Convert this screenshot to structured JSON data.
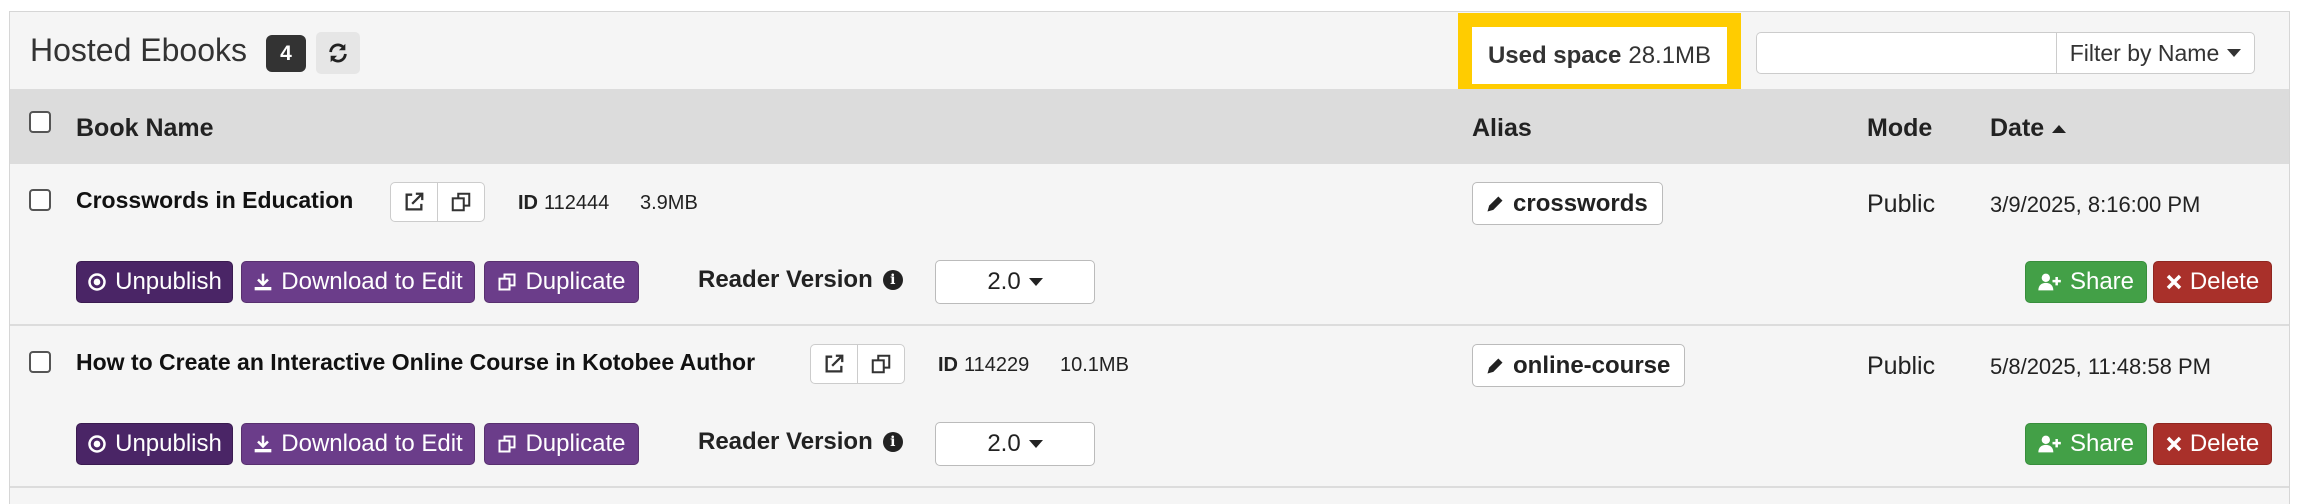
{
  "header": {
    "title": "Hosted Ebooks",
    "count": "4",
    "used_space_label": "Used space",
    "used_space_value": "28.1MB",
    "filter_value": "",
    "filter_button": "Filter by Name"
  },
  "table": {
    "columns": {
      "name": "Book Name",
      "alias": "Alias",
      "mode": "Mode",
      "date": "Date"
    },
    "sort": "date-ascending",
    "rows": [
      {
        "name": "Crosswords in Education",
        "id_label": "ID",
        "id": "112444",
        "size": "3.9MB",
        "alias": "crosswords",
        "mode": "Public",
        "date": "3/9/2025, 8:16:00 PM",
        "unpublish": "Unpublish",
        "download": "Download to Edit",
        "duplicate": "Duplicate",
        "reader_label": "Reader Version",
        "reader_version": "2.0",
        "share": "Share",
        "delete": "Delete"
      },
      {
        "name": "How to Create an Interactive Online Course in Kotobee Author",
        "id_label": "ID",
        "id": "114229",
        "size": "10.1MB",
        "alias": "online-course",
        "mode": "Public",
        "date": "5/8/2025, 11:48:58 PM",
        "unpublish": "Unpublish",
        "download": "Download to Edit",
        "duplicate": "Duplicate",
        "reader_label": "Reader Version",
        "reader_version": "2.0",
        "share": "Share",
        "delete": "Delete"
      }
    ]
  },
  "colors": {
    "highlight": "#ffcc00",
    "purple": "#6b3d8a",
    "dark_purple": "#4a2566",
    "green": "#43a047",
    "red": "#a9302a"
  },
  "icons": [
    "refresh-icon",
    "external-link-icon",
    "copy-icon",
    "pencil-icon",
    "unpublish-icon",
    "download-icon",
    "duplicate-icon",
    "info-icon",
    "add-user-icon",
    "times-icon",
    "caret-down-icon",
    "caret-up-icon"
  ]
}
